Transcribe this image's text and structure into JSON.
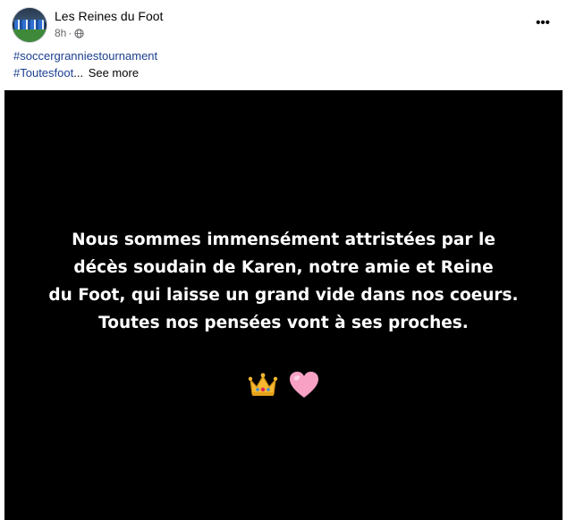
{
  "post": {
    "page_name": "Les Reines du Foot",
    "time": "8h",
    "meta_separator": "·",
    "privacy_icon": "globe-icon",
    "more_icon": "more-horizontal-icon",
    "more_label": "•••",
    "caption": {
      "hashtag_1": "#soccergranniestournament",
      "hashtag_2": "#Toutesfoot",
      "ellipsis": "...",
      "see_more": "See more"
    },
    "media": {
      "lines": [
        "Nous sommes immensément attristées par le",
        "décès soudain de Karen, notre amie et Reine",
        "du Foot, qui laisse un grand vide dans nos coeurs.",
        "Toutes nos pensées vont à ses proches."
      ],
      "emojis": [
        "crown-emoji",
        "pink-heart-emoji"
      ],
      "background": "#000000",
      "text_color": "#ffffff"
    }
  },
  "colors": {
    "hashtag": "#1a3e8f",
    "secondary_text": "#65676b"
  }
}
